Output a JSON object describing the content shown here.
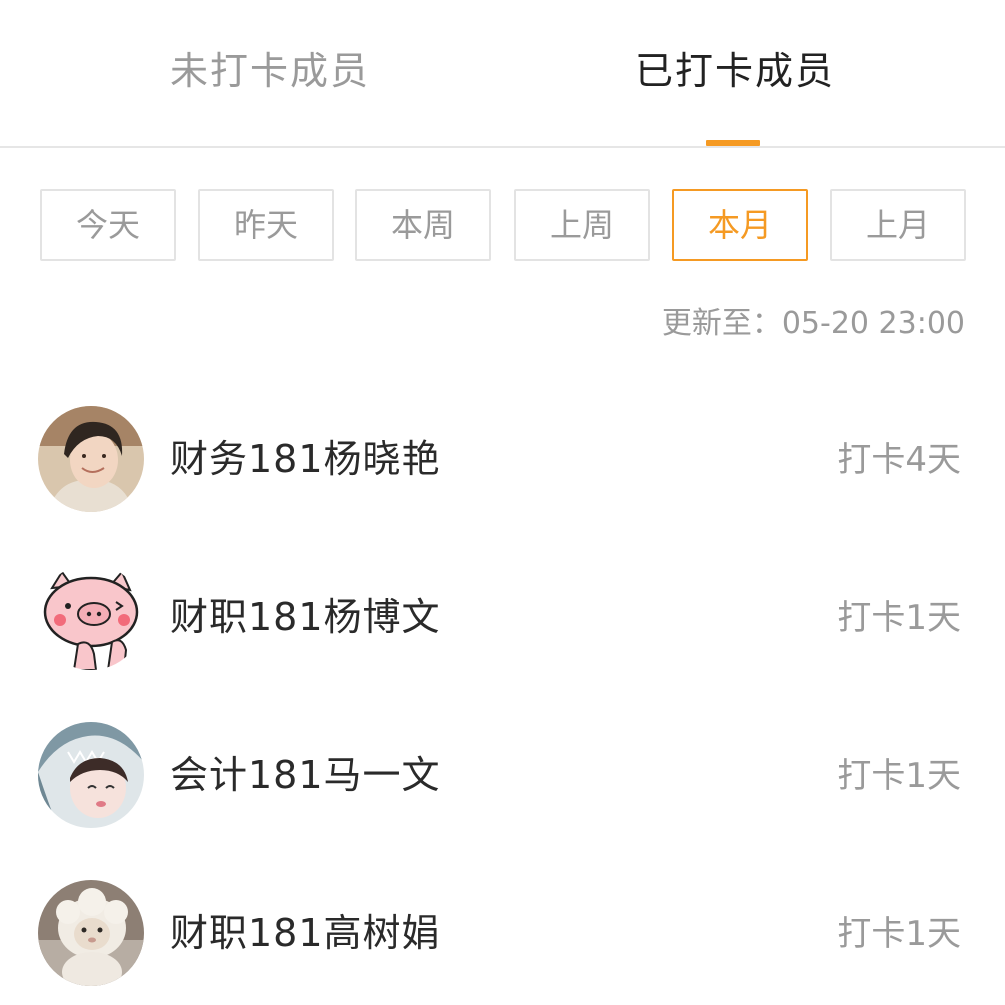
{
  "tabs": {
    "unchecked": "未打卡成员",
    "checked": "已打卡成员",
    "active": "checked"
  },
  "filters": [
    {
      "label": "今天",
      "active": false
    },
    {
      "label": "昨天",
      "active": false
    },
    {
      "label": "本周",
      "active": false
    },
    {
      "label": "上周",
      "active": false
    },
    {
      "label": "本月",
      "active": true
    },
    {
      "label": "上月",
      "active": false
    }
  ],
  "updated_text": "更新至：05-20 23:00",
  "members": [
    {
      "name": "财务181杨晓艳",
      "count": "打卡4天",
      "avatar": "boy-photo"
    },
    {
      "name": "财职181杨博文",
      "count": "打卡1天",
      "avatar": "pig-cartoon"
    },
    {
      "name": "会计181马一文",
      "count": "打卡1天",
      "avatar": "girl-shark-hood-photo"
    },
    {
      "name": "财职181高树娟",
      "count": "打卡1天",
      "avatar": "sheep-plush-photo"
    }
  ],
  "colors": {
    "accent": "#f59a23",
    "muted": "#9a9a9a",
    "text": "#2a2a2a"
  }
}
